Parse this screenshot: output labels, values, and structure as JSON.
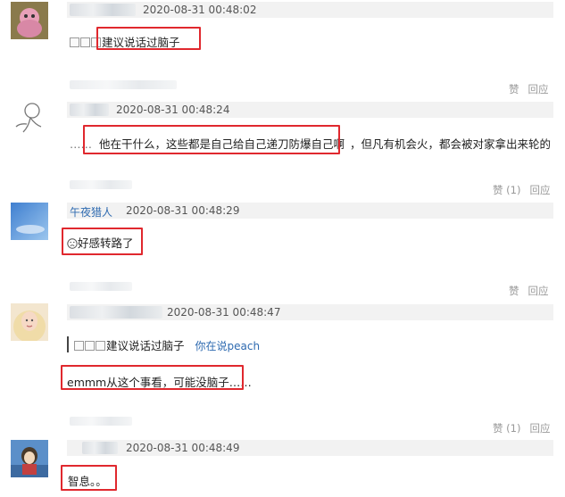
{
  "comments": [
    {
      "time": "2020-08-31 00:48:02",
      "emoji_marks": [
        "□",
        "□",
        "□"
      ],
      "text": "建议说话过脑子"
    },
    {
      "actions": {
        "like": "赞",
        "reply": "回应"
      },
      "time": "2020-08-31 00:48:24",
      "prefix": "……",
      "text": "他在干什么，这些都是自己给自己递刀防爆自己啊",
      "suffix": "，但凡有机会火，都会被对家拿出来轮的"
    },
    {
      "actions": {
        "like": "赞 (1)",
        "reply": "回应"
      },
      "username": "午夜猎人",
      "time": "2020-08-31 00:48:29",
      "text": "好感转路了"
    },
    {
      "actions": {
        "like": "赞",
        "reply": "回应"
      },
      "time": "2020-08-31 00:48:47",
      "quote": {
        "emoji_marks": [
          "□",
          "□",
          "□"
        ],
        "text": "建议说话过脑子",
        "author": "你在说peach"
      },
      "text": "emmm从这个事看，可能没脑子……"
    },
    {
      "actions": {
        "like": "赞 (1)",
        "reply": "回应"
      },
      "time": "2020-08-31 00:48:49",
      "text": "智息。。"
    }
  ],
  "colors": {
    "highlight": "#e0282e",
    "link": "#2e6ab0",
    "meta_band": "#f2f2f2"
  }
}
